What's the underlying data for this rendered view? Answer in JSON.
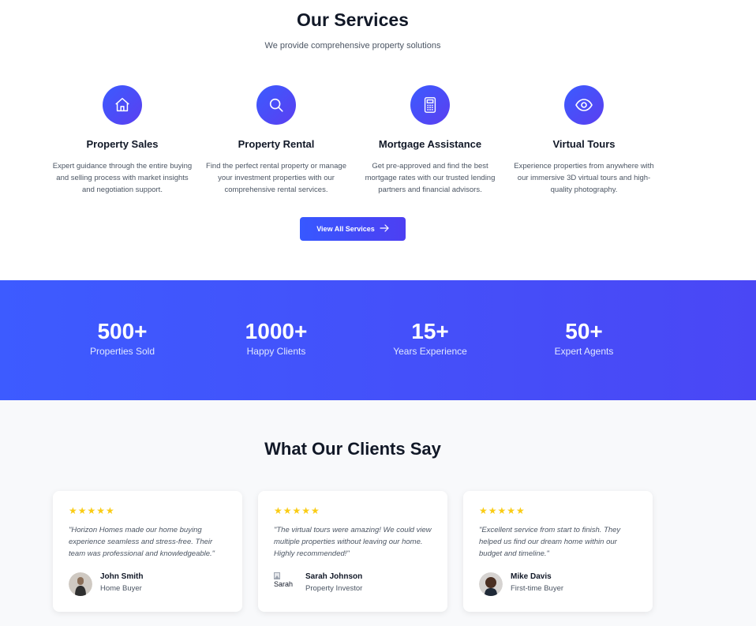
{
  "services": {
    "title": "Our Services",
    "subtitle": "We provide comprehensive property solutions",
    "items": [
      {
        "icon": "home-icon",
        "title": "Property Sales",
        "description": "Expert guidance through the entire buying and selling process with market insights and negotiation support."
      },
      {
        "icon": "search-icon",
        "title": "Property Rental",
        "description": "Find the perfect rental property or manage your investment properties with our comprehensive rental services."
      },
      {
        "icon": "calculator-icon",
        "title": "Mortgage Assistance",
        "description": "Get pre-approved and find the best mortgage rates with our trusted lending partners and financial advisors."
      },
      {
        "icon": "eye-icon",
        "title": "Virtual Tours",
        "description": "Experience properties from anywhere with our immersive 3D virtual tours and high-quality photography."
      }
    ],
    "button_label": "View All Services"
  },
  "stats": [
    {
      "value": "500+",
      "label": "Properties Sold"
    },
    {
      "value": "1000+",
      "label": "Happy Clients"
    },
    {
      "value": "15+",
      "label": "Years Experience"
    },
    {
      "value": "50+",
      "label": "Expert Agents"
    }
  ],
  "testimonials": {
    "title": "What Our Clients Say",
    "items": [
      {
        "rating": 5,
        "quote": "\"Horizon Homes made our home buying experience seamless and stress-free. Their team was professional and knowledgeable.\"",
        "name": "John Smith",
        "role": "Home Buyer"
      },
      {
        "rating": 5,
        "quote": "\"The virtual tours were amazing! We could view multiple properties without leaving our home. Highly recommended!\"",
        "name": "Sarah Johnson",
        "role": "Property Investor",
        "avatar_alt": "Sarah"
      },
      {
        "rating": 5,
        "quote": "\"Excellent service from start to finish. They helped us find our dream home within our budget and timeline.\"",
        "name": "Mike Davis",
        "role": "First-time Buyer"
      }
    ]
  },
  "colors": {
    "accent": "#3d5bff",
    "accent_end": "#4d3ff2",
    "star": "#facc15"
  }
}
